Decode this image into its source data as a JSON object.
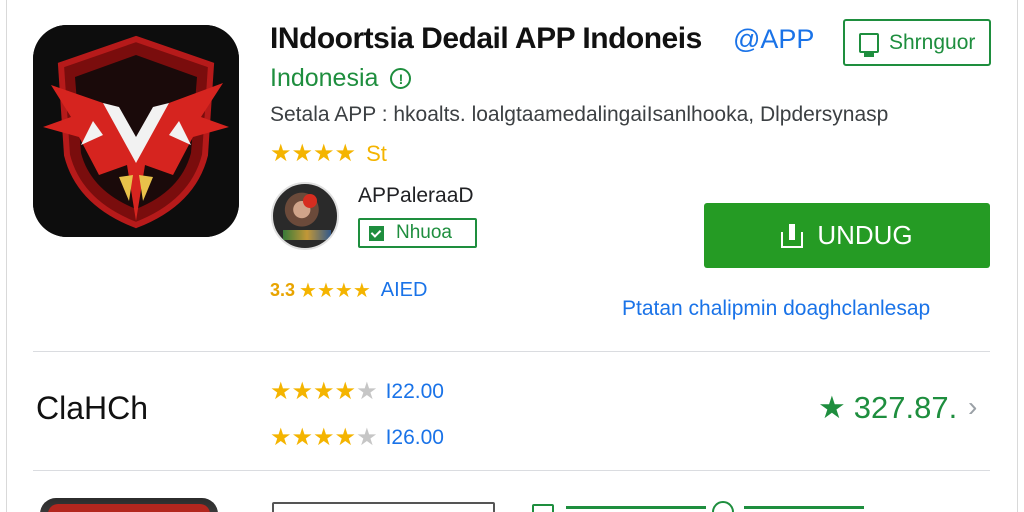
{
  "app": {
    "title": "INdoortsia Dedail APP Indoneis",
    "title_badge": "@APP",
    "developer": "Indonesia",
    "subtitle": "Setala APP : hkoalts. loalgtaamedalingaiIsanlhooka, Dlpdersynasp",
    "rating_stars": "★★★★",
    "rating_value": "St",
    "wishlist_label": "Shrnguor",
    "publisher_name": "APPaleraaD",
    "publisher_badge": "Nhuoa",
    "install_label": "UNDUG",
    "mid_rating_number": "3.3",
    "mid_rating_stars": "★★★★",
    "mid_rating_tag": "AIED",
    "link_text": "Ptatan chalipmin doaghclanlesap"
  },
  "section": {
    "label": "ClaHCh",
    "prices": [
      {
        "stars": "★★★★",
        "stars_off": "★",
        "value": "I22.00"
      },
      {
        "stars": "★★★★",
        "stars_off": "★",
        "value": "I26.00"
      }
    ],
    "score": "327.87.",
    "score_icon": "star-icon"
  },
  "icons": {
    "accent_green": "#1e8e3e",
    "install_green": "#259b24",
    "star_color": "#f4b400",
    "link_blue": "#1a73e8"
  }
}
